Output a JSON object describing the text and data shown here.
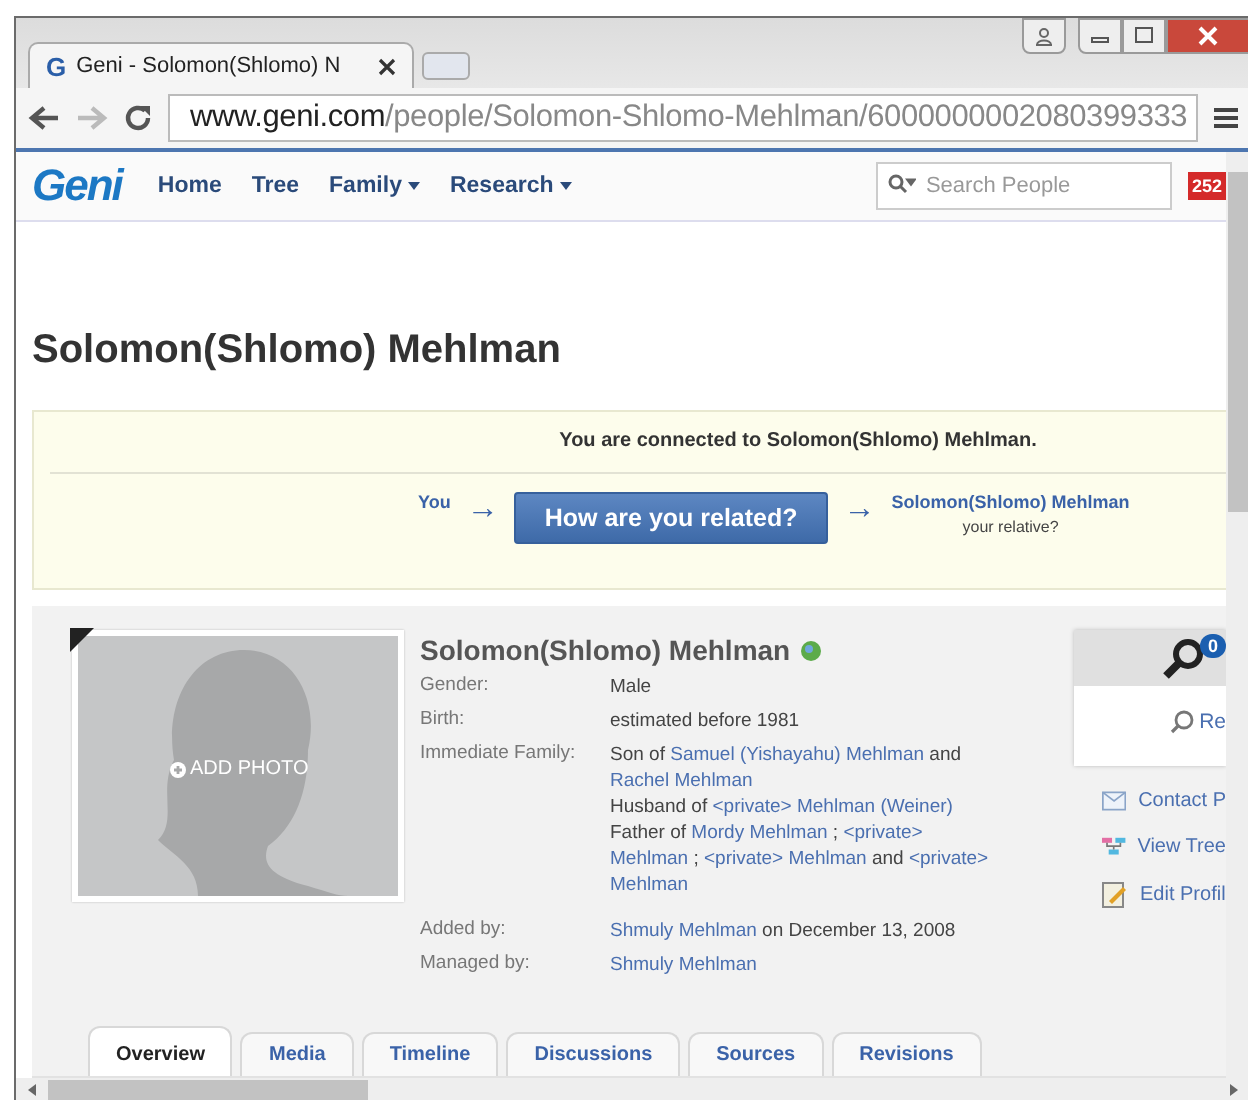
{
  "browser": {
    "favicon": "G",
    "tab_title": "Geni - Solomon(Shlomo) N",
    "url_host": "www.geni.com",
    "url_path": "/people/Solomon-Shlomo-Mehlman/6000000002080399333"
  },
  "nav": {
    "logo": "Geni",
    "items": [
      {
        "label": "Home",
        "dropdown": false
      },
      {
        "label": "Tree",
        "dropdown": false
      },
      {
        "label": "Family",
        "dropdown": true
      },
      {
        "label": "Research",
        "dropdown": true
      }
    ],
    "search_placeholder": "Search People",
    "notification_count": "252"
  },
  "page_title": "Solomon(Shlomo) Mehlman",
  "connection": {
    "message": "You are connected to Solomon(Shlomo) Mehlman.",
    "you": "You",
    "button": "How are you related?",
    "arrow": "→",
    "relative_name": "Solomon(Shlomo) Mehlman",
    "relative_caption": "your relative?"
  },
  "profile": {
    "name": "Solomon(Shlomo) Mehlman",
    "add_photo": "ADD PHOTO",
    "deceased": true,
    "fields": [
      {
        "label": "Gender:",
        "lines": [
          [
            {
              "text": "Male",
              "link": false
            }
          ]
        ]
      },
      {
        "label": "Birth:",
        "lines": [
          [
            {
              "text": "estimated before 1981",
              "link": false
            }
          ]
        ]
      },
      {
        "label": "Immediate Family:",
        "lines": [
          [
            {
              "text": "Son of ",
              "link": false
            },
            {
              "text": "Samuel (Yishayahu) Mehlman",
              "link": true
            },
            {
              "text": " and",
              "link": false
            }
          ],
          [
            {
              "text": "Rachel Mehlman",
              "link": true
            }
          ],
          [
            {
              "text": "Husband of ",
              "link": false
            },
            {
              "text": "<private> Mehlman (Weiner)",
              "link": true
            }
          ],
          [
            {
              "text": "Father of ",
              "link": false
            },
            {
              "text": "Mordy Mehlman",
              "link": true
            },
            {
              "text": " ; ",
              "link": false
            },
            {
              "text": "<private>",
              "link": true
            }
          ],
          [
            {
              "text": "Mehlman",
              "link": true
            },
            {
              "text": " ; ",
              "link": false
            },
            {
              "text": "<private> Mehlman",
              "link": true
            },
            {
              "text": " and ",
              "link": false
            },
            {
              "text": "<private>",
              "link": true
            }
          ],
          [
            {
              "text": "Mehlman",
              "link": true
            }
          ]
        ]
      },
      {
        "label": "Added by:",
        "lines": [
          [
            {
              "text": "Shmuly Mehlman",
              "link": true
            },
            {
              "text": " on December 13, 2008",
              "link": false
            }
          ]
        ]
      },
      {
        "label": "Managed by:",
        "lines": [
          [
            {
              "text": "Shmuly Mehlman",
              "link": true
            }
          ]
        ]
      }
    ]
  },
  "side": {
    "badge": "0",
    "search_link": "Re",
    "actions": [
      {
        "kind": "mail",
        "label": "Contact P"
      },
      {
        "kind": "tree",
        "label": "View Tree"
      },
      {
        "kind": "edit",
        "label": "Edit Profil"
      }
    ]
  },
  "tabs": [
    {
      "label": "Overview",
      "selected": true
    },
    {
      "label": "Media",
      "selected": false
    },
    {
      "label": "Timeline",
      "selected": false
    },
    {
      "label": "Discussions",
      "selected": false
    },
    {
      "label": "Sources",
      "selected": false
    },
    {
      "label": "Revisions",
      "selected": false
    }
  ]
}
